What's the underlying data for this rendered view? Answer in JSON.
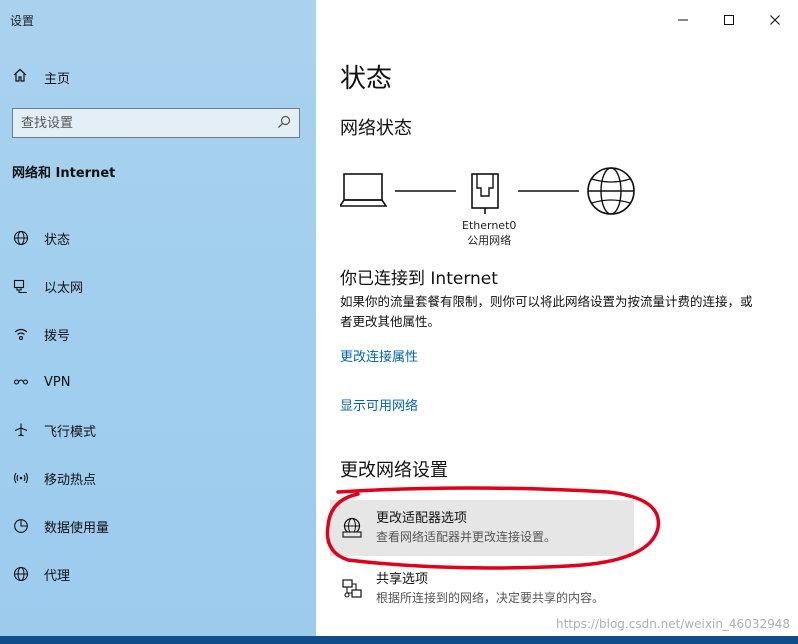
{
  "app": {
    "title": "设置"
  },
  "sidebar": {
    "home_label": "主页",
    "search_placeholder": "查找设置",
    "section_title": "网络和 Internet",
    "items": [
      {
        "label": "状态",
        "icon": "globe-network-icon"
      },
      {
        "label": "以太网",
        "icon": "ethernet-icon"
      },
      {
        "label": "拨号",
        "icon": "dialup-icon"
      },
      {
        "label": "VPN",
        "icon": "vpn-icon"
      },
      {
        "label": "飞行模式",
        "icon": "airplane-icon"
      },
      {
        "label": "移动热点",
        "icon": "hotspot-icon"
      },
      {
        "label": "数据使用量",
        "icon": "data-usage-icon"
      },
      {
        "label": "代理",
        "icon": "proxy-globe-icon"
      }
    ]
  },
  "main": {
    "page_title": "状态",
    "network_status_heading": "网络状态",
    "adapter": {
      "name": "Ethernet0",
      "profile": "公用网络"
    },
    "connected_title": "你已连接到 Internet",
    "connected_desc": "如果你的流量套餐有限制，则你可以将此网络设置为按流量计费的连接，或者更改其他属性。",
    "links": {
      "change_properties": "更改连接属性",
      "show_networks": "显示可用网络"
    },
    "change_settings_heading": "更改网络设置",
    "options": [
      {
        "title": "更改适配器选项",
        "desc": "查看网络适配器并更改连接设置。"
      },
      {
        "title": "共享选项",
        "desc": "根据所连接到的网络，决定要共享的内容。"
      }
    ]
  },
  "watermark": "https://blog.csdn.net/weixin_46032948",
  "colors": {
    "sidebar_bg": "#a2cfee",
    "link": "#0063b1",
    "annotation": "#e0001a",
    "highlight": "#e6e6e6"
  }
}
